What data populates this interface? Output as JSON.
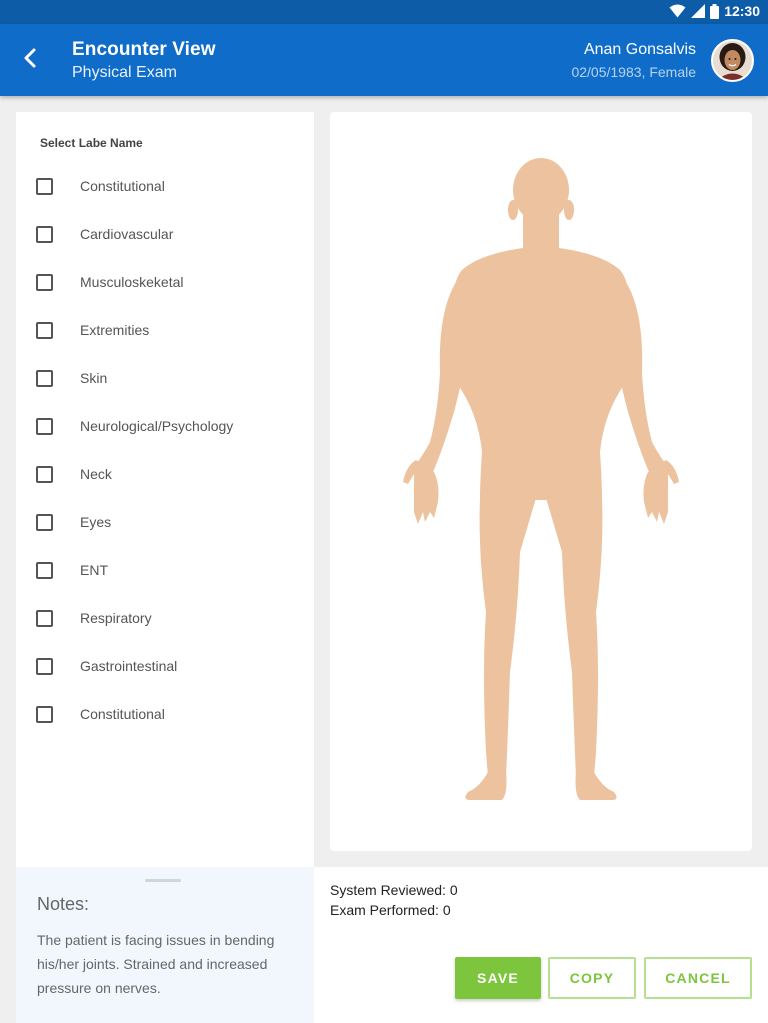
{
  "status_bar": {
    "time": "12:30",
    "icons": [
      "wifi-icon",
      "signal-icon",
      "battery-icon"
    ]
  },
  "app_bar": {
    "title": "Encounter View",
    "subtitle": "Physical Exam",
    "patient_name": "Anan Gonsalvis",
    "patient_meta": "02/05/1983, Female",
    "back_icon": "chevron-left-icon"
  },
  "left_panel": {
    "header": "Select Labe Name",
    "items": [
      {
        "label": "Constitutional",
        "checked": false
      },
      {
        "label": "Cardiovascular",
        "checked": false
      },
      {
        "label": "Musculoskeketal",
        "checked": false
      },
      {
        "label": "Extremities",
        "checked": false
      },
      {
        "label": "Skin",
        "checked": false
      },
      {
        "label": "Neurological/Psychology",
        "checked": false
      },
      {
        "label": "Neck",
        "checked": false
      },
      {
        "label": "Eyes",
        "checked": false
      },
      {
        "label": "ENT",
        "checked": false
      },
      {
        "label": "Respiratory",
        "checked": false
      },
      {
        "label": "Gastrointestinal",
        "checked": false
      },
      {
        "label": "Constitutional",
        "checked": false
      }
    ]
  },
  "notes": {
    "title": "Notes:",
    "text": "The patient is facing issues in bending his/her joints. Strained and increased pressure on nerves."
  },
  "stats": {
    "system_reviewed": "System Reviewed: 0",
    "exam_performed": "Exam Performed: 0"
  },
  "actions": {
    "save": "SAVE",
    "copy": "COPY",
    "cancel": "CANCEL"
  },
  "colors": {
    "app_bar": "#0f6cc9",
    "status_bar": "#0d5ca8",
    "accent_green": "#7cc53c",
    "skin": "#edc29e"
  }
}
